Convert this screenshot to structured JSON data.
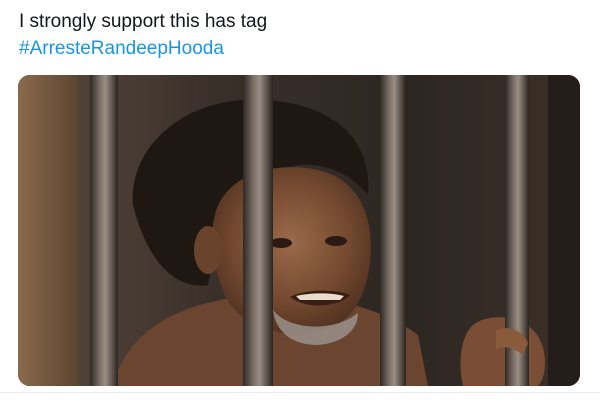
{
  "tweet": {
    "text": "I strongly support this has tag",
    "hashtag": "#ArresteRandeepHooda"
  },
  "media": {
    "subject": "man-behind-prison-bars-photo"
  },
  "colors": {
    "text": "#14171a",
    "link": "#1b95e0",
    "divider": "#e6ecf0"
  }
}
